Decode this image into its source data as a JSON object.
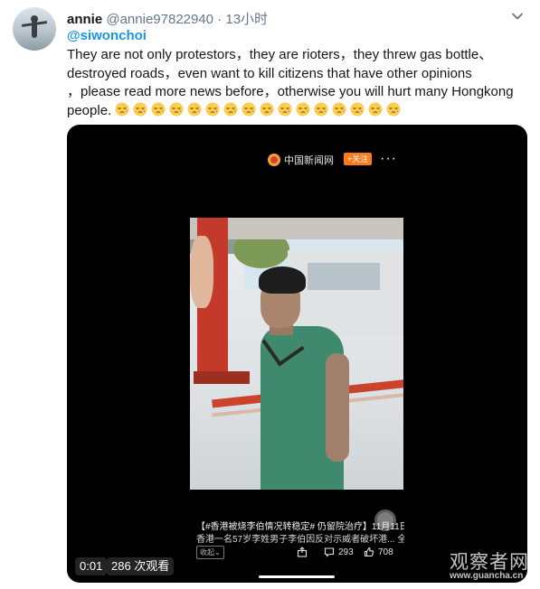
{
  "tweet": {
    "display_name": "annie",
    "handle": "@annie97822940",
    "separator": "·",
    "time": "13小时",
    "mention": "@siwonchoi",
    "body_lines": [
      "They are not only protestors，they are rioters，they threw gas bottle、",
      "destroyed roads，even want to kill citizens that have other opinions",
      "，please read more news before，otherwise you will hurt many Hongkong",
      "people."
    ],
    "emoji_name": "sleepy-face-emoji",
    "emoji_count": 16,
    "avatar_icon": "person-on-beach-avatar",
    "menu_icon": "chevron-down-icon"
  },
  "video": {
    "source_name": "中国新闻网",
    "follow_label": "+关注",
    "more_label": "···",
    "caption_line1": "【#香港被烧李伯情况转稳定# 仍留院治疗】11月11日，",
    "caption_line2": "香港一名57岁李姓男子李伯因反对示威者破坏港... 全文",
    "collapse_label": "收起",
    "comments": "293",
    "likes": "708",
    "timestamp": "0:01",
    "views": "286 次观看"
  },
  "watermark": {
    "cn": "观察者网",
    "url": "www.guancha.cn"
  },
  "colors": {
    "link": "#1b95e0",
    "muted": "#657786",
    "follow": "#ff7a1a"
  }
}
